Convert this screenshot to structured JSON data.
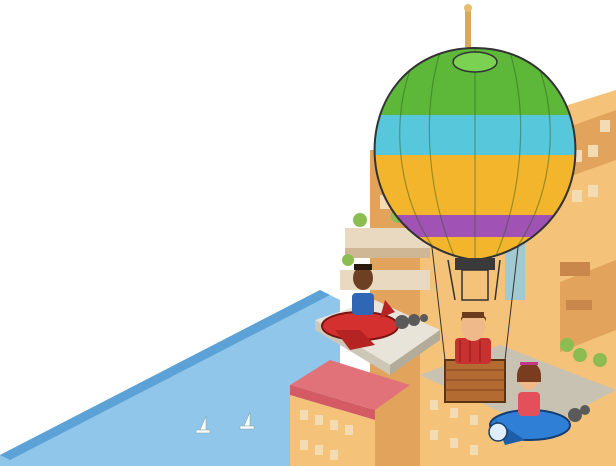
{
  "scene": {
    "kind": "pixel-art isometric city scene",
    "colors": {
      "background": "#ffffff",
      "water": "#8fc6ea",
      "water_edge": "#5da2d6",
      "building_wall": "#f5c27a",
      "building_shadow": "#e2a45c",
      "window": "#f3dcb4",
      "roof_red": "#e2727a",
      "balloon_green": "#5db83a",
      "balloon_cyan": "#57c7dc",
      "balloon_orange": "#f3b52c",
      "balloon_purple": "#a152b5",
      "plane_red": "#d4302f",
      "plane_blue": "#2f7fd6",
      "basket": "#b36b32"
    },
    "icons": [
      "hot-air-balloon-icon",
      "red-plane-icon",
      "blue-plane-icon",
      "sailboat-icon",
      "tower-antenna-icon"
    ]
  }
}
